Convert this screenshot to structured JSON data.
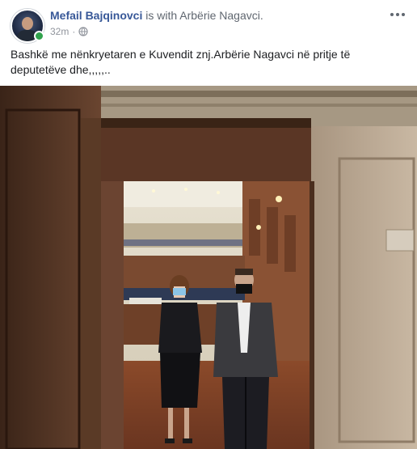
{
  "post": {
    "author_name": "Mefail Bajqinovci",
    "with_text": " is with ",
    "tagged_name": "Arbërie Nagavci",
    "tagged_suffix": ".",
    "timestamp": "32m",
    "separator": "·",
    "privacy_icon": "globe-icon",
    "more_icon": "more-options-icon",
    "text": "Bashkë me nënkryetaren e Kuvendit znj.Arbërie Nagavci në pritje të deputetëve dhe,,,,,..",
    "photo_icon": "photo"
  },
  "colors": {
    "author": "#385898",
    "meta": "#90949c",
    "online": "#31a24c"
  }
}
